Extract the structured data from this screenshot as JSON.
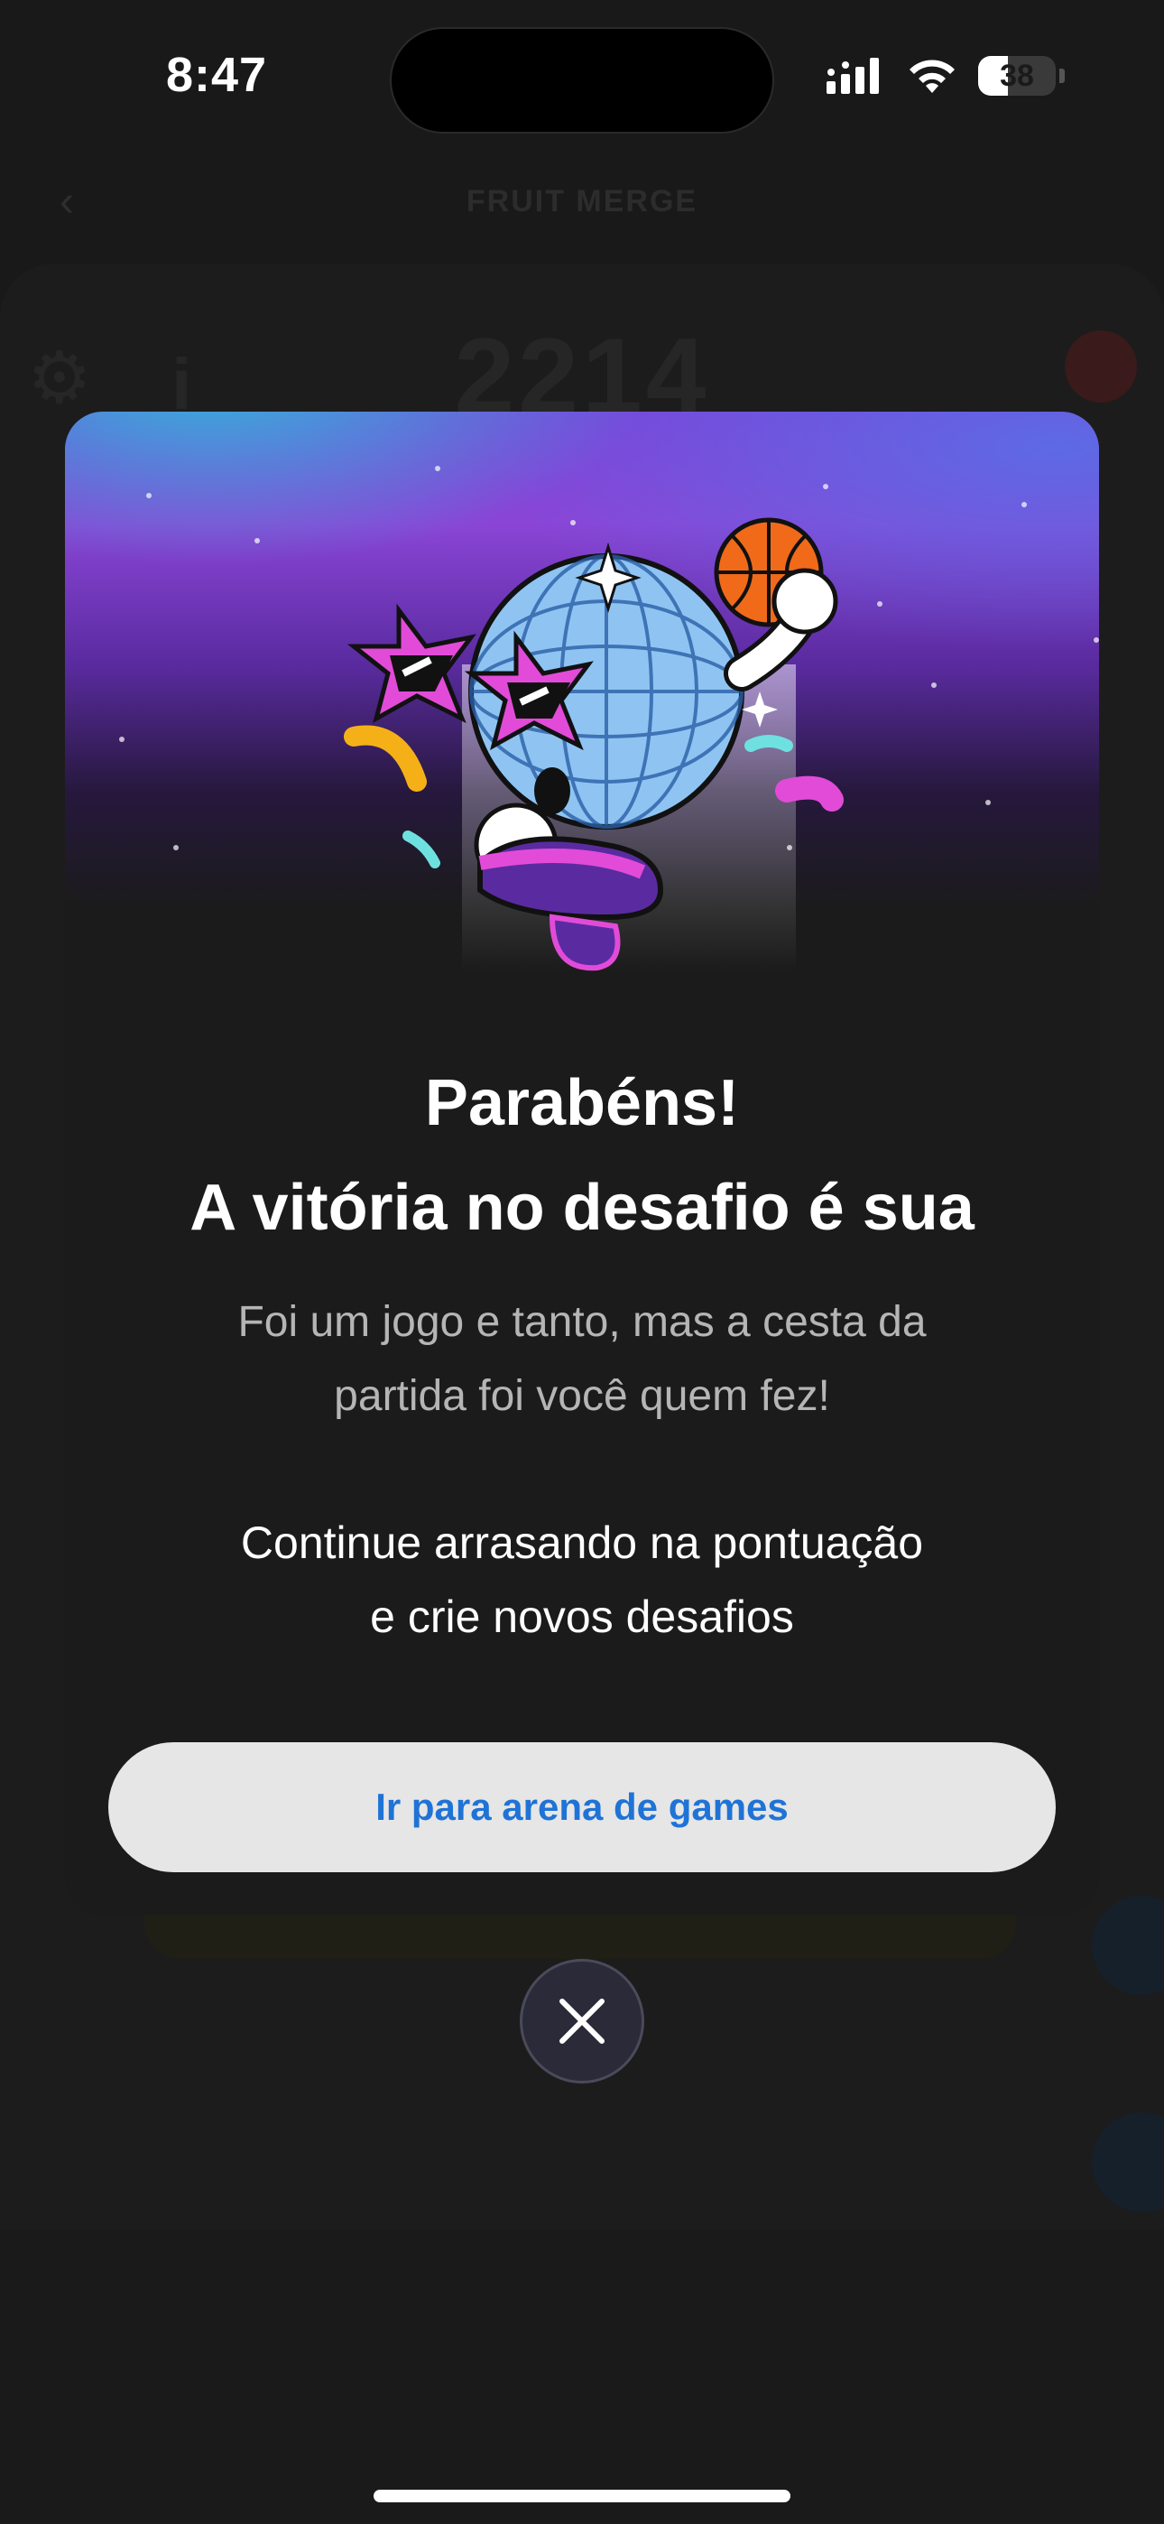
{
  "status_bar": {
    "time": "8:47",
    "battery_level": "38",
    "signal_icon": "cellular-signal-icon",
    "wifi_icon": "wifi-icon",
    "battery_icon": "battery-icon"
  },
  "background": {
    "header_title": "FRUIT MERGE",
    "score": "2214"
  },
  "modal": {
    "title_line1": "Parabéns!",
    "title_line2": "A vitória no desafio é sua",
    "subtitle_line1": "Foi um jogo e tanto, mas a cesta da",
    "subtitle_line2": "partida foi você quem fez!",
    "cta_line1": "Continue arrasando na pontuação",
    "cta_line2": "e crie novos desafios",
    "button_label": "Ir para arena de games",
    "illustration": "disco-ball-mascot-with-basketball"
  },
  "close_icon": "close-icon",
  "colors": {
    "button_text": "#1f73d6",
    "button_bg": "#e6e6e6",
    "modal_bg": "#1b1b1c",
    "hero_purple": "#8a45d6",
    "hero_cyan": "#28c8dc"
  }
}
